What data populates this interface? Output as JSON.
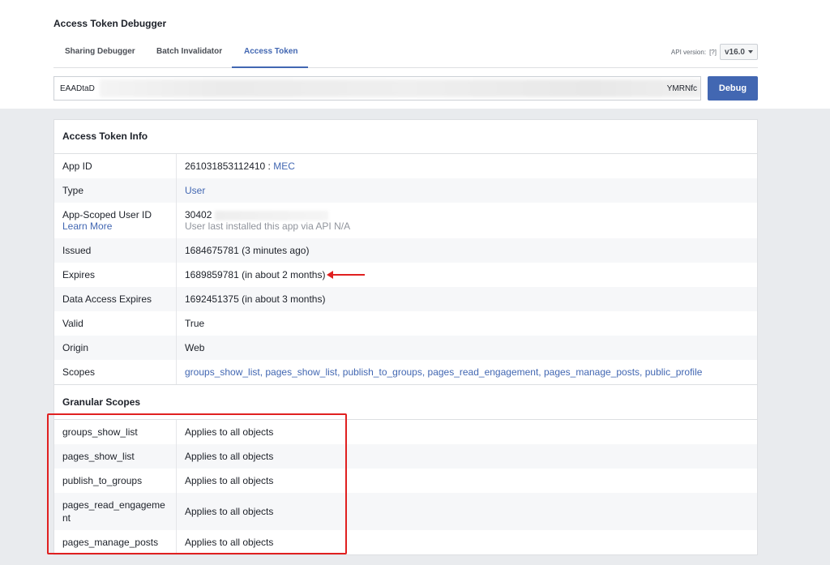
{
  "page": {
    "title": "Access Token Debugger"
  },
  "tabs": [
    {
      "label": "Sharing Debugger",
      "active": false
    },
    {
      "label": "Batch Invalidator",
      "active": false
    },
    {
      "label": "Access Token",
      "active": true
    }
  ],
  "api": {
    "label": "API version:",
    "help": "[?]",
    "version": "v16.0"
  },
  "token": {
    "start": "EAADtaD",
    "end": "YMRNfc"
  },
  "debug_button": "Debug",
  "info": {
    "heading": "Access Token Info",
    "app_id": {
      "label": "App ID",
      "value": "261031853112410 : ",
      "app_name": "MEC"
    },
    "type": {
      "label": "Type",
      "value": "User"
    },
    "user_id": {
      "label": "App-Scoped User ID",
      "learn_more": "Learn More",
      "value": "30402",
      "sub": "User last installed this app via API N/A"
    },
    "issued": {
      "label": "Issued",
      "value": "1684675781 (3 minutes ago)"
    },
    "expires": {
      "label": "Expires",
      "value": "1689859781 (in about 2 months)"
    },
    "data_access": {
      "label": "Data Access Expires",
      "value": "1692451375 (in about 3 months)"
    },
    "valid": {
      "label": "Valid",
      "value": "True"
    },
    "origin": {
      "label": "Origin",
      "value": "Web"
    },
    "scopes": {
      "label": "Scopes",
      "value": "groups_show_list, pages_show_list, publish_to_groups, pages_read_engagement, pages_manage_posts, public_profile"
    }
  },
  "granular": {
    "heading": "Granular Scopes",
    "rows": [
      {
        "scope": "groups_show_list",
        "applies": "Applies to all objects"
      },
      {
        "scope": "pages_show_list",
        "applies": "Applies to all objects"
      },
      {
        "scope": "publish_to_groups",
        "applies": "Applies to all objects"
      },
      {
        "scope": "pages_read_engageme\nnt",
        "applies": "Applies to all objects"
      },
      {
        "scope": "pages_manage_posts",
        "applies": "Applies to all objects"
      }
    ]
  },
  "colors": {
    "accent": "#4267b2",
    "annotation": "#e02020"
  }
}
